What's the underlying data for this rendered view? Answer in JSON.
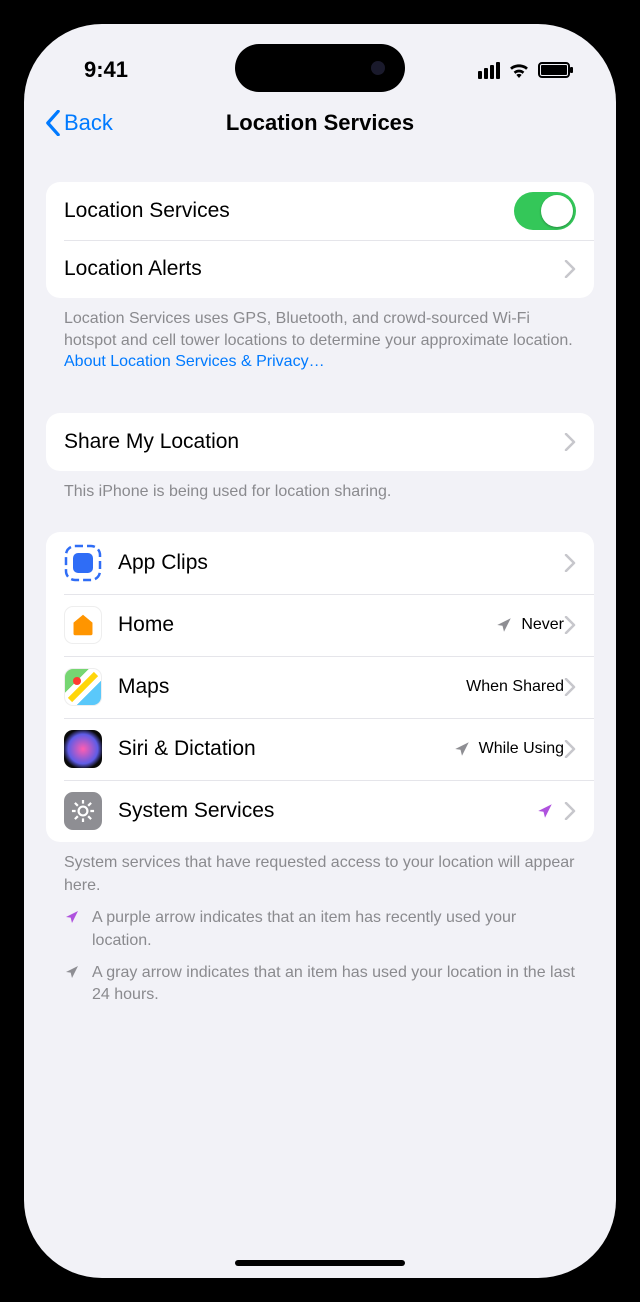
{
  "status": {
    "time": "9:41"
  },
  "nav": {
    "back": "Back",
    "title": "Location Services"
  },
  "section1": {
    "locationServices": "Location Services",
    "locationAlerts": "Location Alerts",
    "footer": "Location Services uses GPS, Bluetooth, and crowd-sourced Wi-Fi hotspot and cell tower locations to determine your approximate location. ",
    "footerLink": "About Location Services & Privacy…"
  },
  "section2": {
    "shareMyLocation": "Share My Location",
    "footer": "This iPhone is being used for location sharing."
  },
  "apps": {
    "appClips": {
      "label": "App Clips",
      "value": "",
      "indicator": "none"
    },
    "home": {
      "label": "Home",
      "value": "Never",
      "indicator": "gray"
    },
    "maps": {
      "label": "Maps",
      "value": "When Shared",
      "indicator": "none"
    },
    "siri": {
      "label": "Siri & Dictation",
      "value": "While Using",
      "indicator": "gray"
    },
    "system": {
      "label": "System Services",
      "value": "",
      "indicator": "purple"
    }
  },
  "section3Footer": "System services that have requested access to your location will appear here.",
  "legend": {
    "purple": "A purple arrow indicates that an item has recently used your location.",
    "gray": "A gray arrow indicates that an item has used your location in the last 24 hours."
  }
}
